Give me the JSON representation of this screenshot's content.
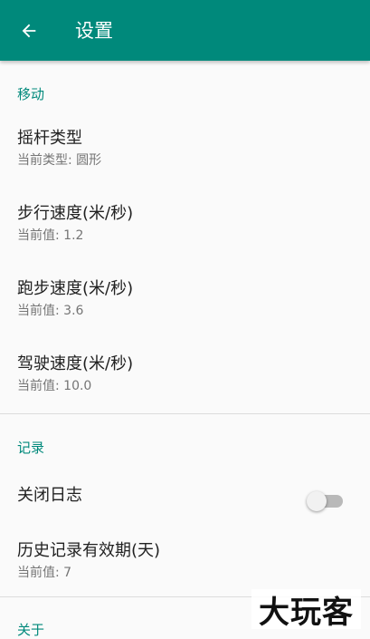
{
  "appbar": {
    "title": "设置",
    "background": "#00897b",
    "back_icon": "arrow-left-icon"
  },
  "sections": {
    "move": {
      "header": "移动",
      "items": [
        {
          "title": "摇杆类型",
          "summary": "当前类型: 圆形"
        },
        {
          "title": "步行速度(米/秒)",
          "summary": "当前值: 1.2"
        },
        {
          "title": "跑步速度(米/秒)",
          "summary": "当前值: 3.6"
        },
        {
          "title": "驾驶速度(米/秒)",
          "summary": "当前值: 10.0"
        }
      ]
    },
    "record": {
      "header": "记录",
      "items": [
        {
          "title": "关闭日志",
          "switch_on": false
        },
        {
          "title": "历史记录有效期(天)",
          "summary": "当前值: 7"
        }
      ]
    },
    "about": {
      "header": "关于"
    }
  },
  "watermark": {
    "text": "大玩客"
  },
  "colors": {
    "accent": "#00897b",
    "title_text": "#212121",
    "summary_text": "#757575"
  }
}
